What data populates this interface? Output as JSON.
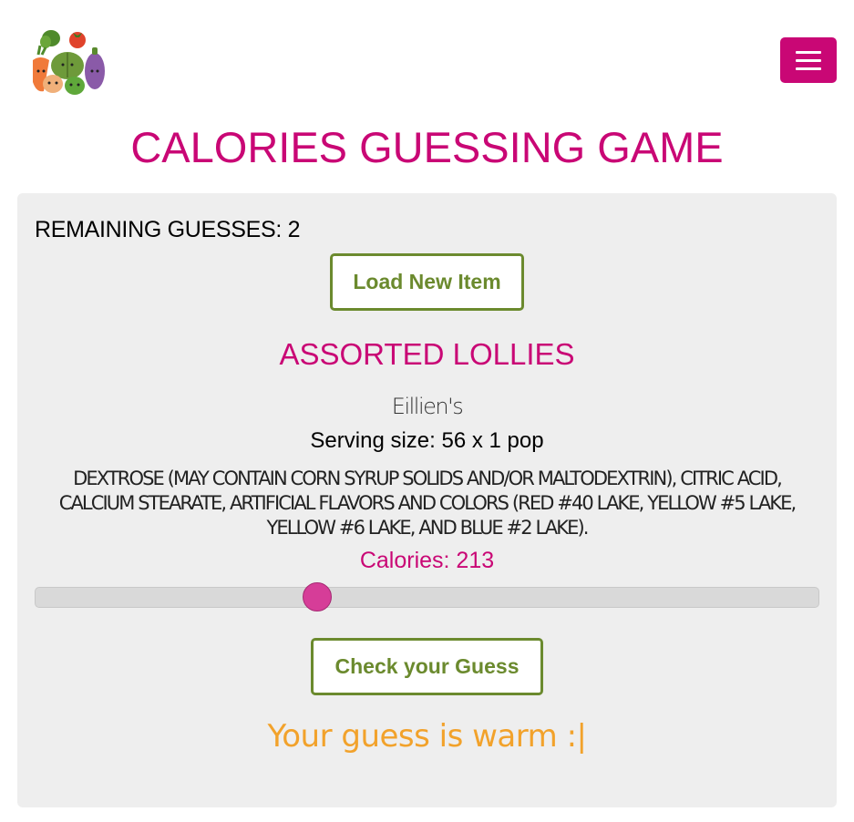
{
  "header": {
    "logo_icon": "vegetables-logo-icon",
    "menu_icon": "hamburger-menu-icon"
  },
  "page": {
    "title": "CALORIES GUESSING GAME"
  },
  "game": {
    "remaining_guesses": "REMAINING GUESSES: 2",
    "load_button_label": "Load New Item",
    "item_name": "ASSORTED LOLLIES",
    "brand": "Eillien's",
    "serving_size": "Serving size: 56 x 1 pop",
    "ingredients": "DEXTROSE (MAY CONTAIN CORN SYRUP SOLIDS AND/OR MALTODEXTRIN), CITRIC ACID, CALCIUM STEARATE, ARTIFICIAL FLAVORS AND COLORS (RED #40 LAKE, YELLOW #5 LAKE, YELLOW #6 LAKE, AND BLUE #2 LAKE).",
    "calories_label": "Calories: 213",
    "slider_fraction": 0.36,
    "check_button_label": "Check your Guess",
    "result_message": "Your guess is warm :|"
  },
  "colors": {
    "accent": "#c90775",
    "button_green": "#6b8a2e",
    "panel_bg": "#eeeeee",
    "result_orange": "#f2a22b",
    "slider_thumb": "#d63d98"
  }
}
